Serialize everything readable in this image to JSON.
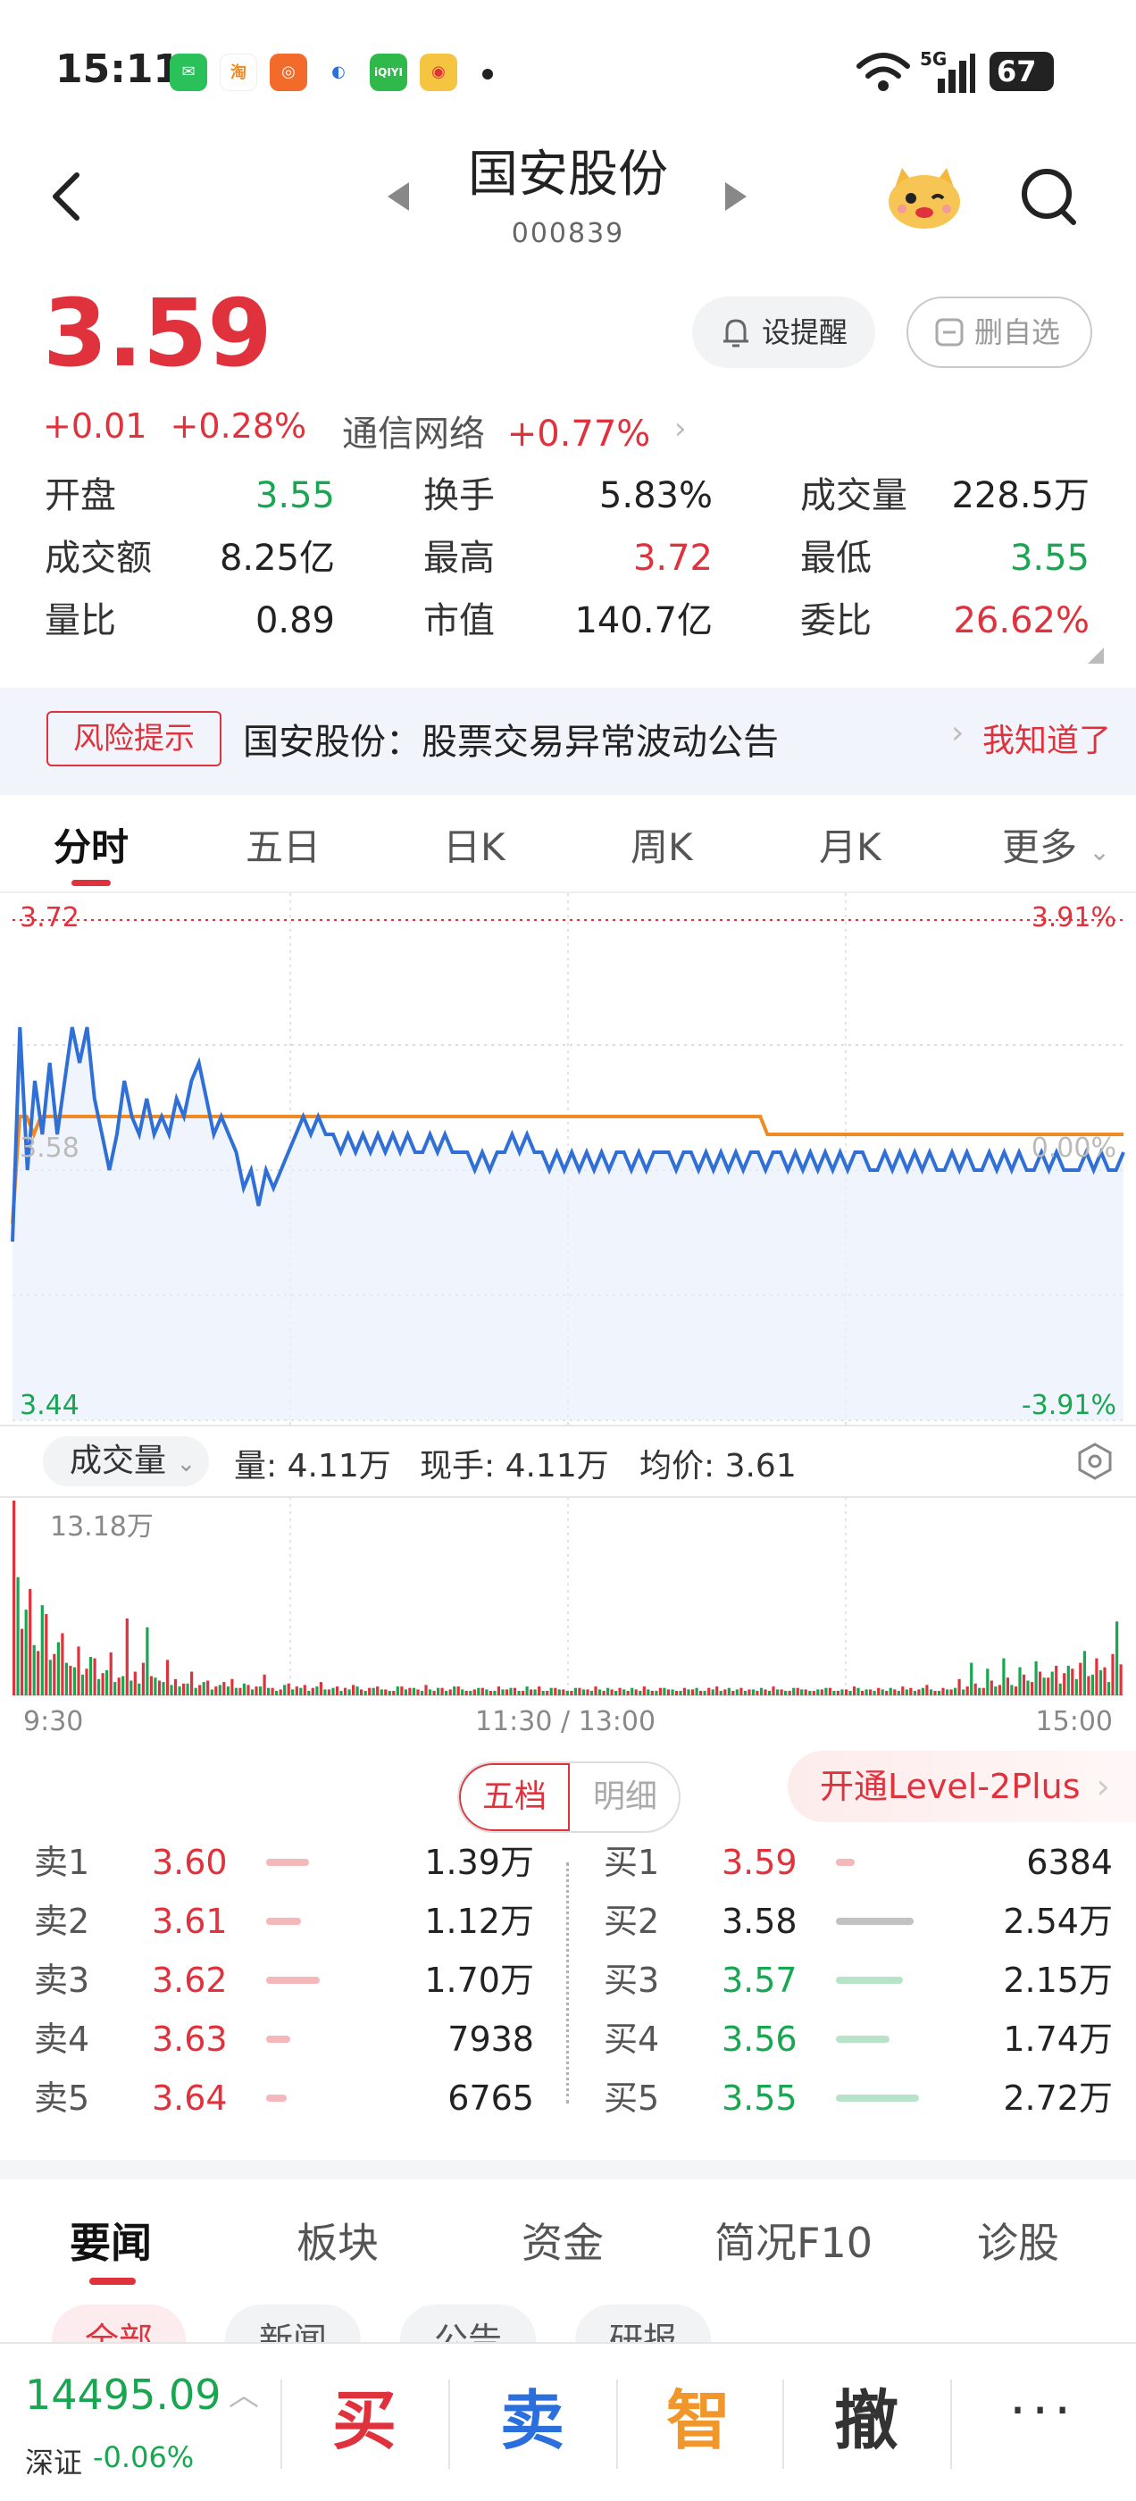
{
  "status_bar": {
    "time": "15:11",
    "network": "5G",
    "battery": "67"
  },
  "header": {
    "stock_name": "国安股份",
    "stock_code": "000839"
  },
  "quote": {
    "price": "3.59",
    "change": "+0.01",
    "change_pct": "+0.28%",
    "sector_name": "通信网络",
    "sector_pct": "+0.77%",
    "alert_label": "设提醒",
    "unfavorite_label": "删自选"
  },
  "stats": [
    {
      "label": "开盘",
      "value": "3.55",
      "color": "#18a651"
    },
    {
      "label": "换手",
      "value": "5.83%",
      "color": "#222222"
    },
    {
      "label": "成交量",
      "value": "228.5万",
      "color": "#222222"
    },
    {
      "label": "成交额",
      "value": "8.25亿",
      "color": "#222222"
    },
    {
      "label": "最高",
      "value": "3.72",
      "color": "#e0323c"
    },
    {
      "label": "最低",
      "value": "3.55",
      "color": "#18a651"
    },
    {
      "label": "量比",
      "value": "0.89",
      "color": "#222222"
    },
    {
      "label": "市值",
      "value": "140.7亿",
      "color": "#222222"
    },
    {
      "label": "委比",
      "value": "26.62%",
      "color": "#e0323c"
    }
  ],
  "risk_banner": {
    "tag": "风险提示",
    "message": "国安股份：股票交易异常波动公告",
    "action": "我知道了"
  },
  "chart_tabs": [
    "分时",
    "五日",
    "日K",
    "周K",
    "月K",
    "更多"
  ],
  "chart_data": [
    {
      "type": "line",
      "title": "分时",
      "y_labels": {
        "top": "3.72",
        "middle": "3.58",
        "bottom": "3.44"
      },
      "pct_labels": {
        "top": "3.91%",
        "middle": "0.00%",
        "bottom": "-3.91%"
      },
      "ylim": [
        3.44,
        3.72
      ],
      "prev_close": 3.58,
      "series": [
        {
          "color": "#2f6fd6",
          "values": [
            3.54,
            3.66,
            3.58,
            3.63,
            3.6,
            3.64,
            3.6,
            3.63,
            3.66,
            3.64,
            3.66,
            3.62,
            3.6,
            3.58,
            3.6,
            3.63,
            3.61,
            3.6,
            3.62,
            3.6,
            3.61,
            3.6,
            3.62,
            3.61,
            3.63,
            3.64,
            3.62,
            3.6,
            3.61,
            3.6,
            3.59,
            3.57,
            3.58,
            3.56,
            3.58,
            3.57,
            3.58,
            3.59,
            3.6,
            3.61,
            3.6,
            3.61,
            3.6,
            3.6,
            3.59,
            3.6,
            3.59,
            3.6,
            3.59,
            3.6,
            3.59,
            3.6,
            3.59,
            3.6,
            3.59,
            3.59,
            3.6,
            3.59,
            3.6,
            3.59,
            3.59,
            3.59,
            3.58,
            3.59,
            3.58,
            3.59,
            3.59,
            3.6,
            3.59,
            3.6,
            3.59,
            3.59,
            3.58,
            3.59,
            3.58,
            3.59,
            3.58,
            3.59,
            3.58,
            3.59,
            3.58,
            3.59,
            3.59,
            3.58,
            3.59,
            3.58,
            3.59,
            3.59,
            3.59,
            3.58,
            3.59,
            3.59,
            3.58,
            3.59,
            3.58,
            3.59,
            3.58,
            3.59,
            3.58,
            3.59,
            3.59,
            3.58,
            3.59,
            3.59,
            3.58,
            3.59,
            3.58,
            3.59,
            3.58,
            3.59,
            3.58,
            3.59,
            3.58,
            3.59,
            3.59,
            3.58,
            3.58,
            3.59,
            3.58,
            3.59,
            3.58,
            3.59,
            3.58,
            3.59,
            3.58,
            3.58,
            3.59,
            3.58,
            3.59,
            3.58,
            3.58,
            3.59,
            3.58,
            3.59,
            3.58,
            3.59,
            3.58,
            3.58,
            3.59,
            3.58,
            3.59,
            3.58,
            3.58,
            3.58,
            3.59,
            3.58,
            3.59,
            3.58,
            3.58,
            3.59
          ]
        },
        {
          "color": "#f08a24",
          "values": [
            3.55,
            3.61,
            3.61,
            3.6,
            3.61,
            3.61,
            3.61,
            3.61,
            3.61,
            3.61,
            3.61,
            3.61,
            3.61,
            3.61,
            3.61,
            3.61,
            3.61,
            3.61,
            3.61,
            3.61,
            3.61,
            3.61,
            3.61,
            3.61,
            3.61,
            3.61,
            3.61,
            3.61,
            3.61,
            3.61,
            3.61,
            3.61,
            3.61,
            3.61,
            3.61,
            3.61,
            3.61,
            3.61,
            3.61,
            3.61,
            3.61,
            3.61,
            3.61,
            3.61,
            3.61,
            3.61,
            3.61,
            3.61,
            3.61,
            3.61,
            3.61,
            3.61,
            3.61,
            3.61,
            3.61,
            3.61,
            3.61,
            3.61,
            3.61,
            3.61,
            3.61,
            3.61,
            3.61,
            3.61,
            3.61,
            3.61,
            3.61,
            3.61,
            3.61,
            3.61,
            3.61,
            3.61,
            3.61,
            3.61,
            3.61,
            3.61,
            3.61,
            3.61,
            3.61,
            3.61,
            3.61,
            3.61,
            3.61,
            3.61,
            3.61,
            3.61,
            3.61,
            3.61,
            3.61,
            3.61,
            3.61,
            3.61,
            3.61,
            3.61,
            3.61,
            3.61,
            3.61,
            3.61,
            3.61,
            3.61,
            3.61,
            3.61,
            3.61,
            3.61,
            3.61,
            3.61,
            3.6,
            3.6,
            3.6,
            3.6,
            3.6,
            3.6,
            3.6,
            3.6,
            3.6,
            3.6,
            3.6,
            3.6,
            3.6,
            3.6,
            3.6,
            3.6,
            3.6,
            3.6,
            3.6,
            3.6,
            3.6,
            3.6,
            3.6,
            3.6,
            3.6,
            3.6,
            3.6,
            3.6,
            3.6,
            3.6,
            3.6,
            3.6,
            3.6,
            3.6,
            3.6,
            3.6,
            3.6,
            3.6,
            3.6,
            3.6,
            3.6,
            3.6,
            3.6,
            3.6,
            3.6,
            3.6,
            3.6,
            3.6,
            3.6,
            3.6,
            3.6
          ]
        }
      ],
      "grid": true
    },
    {
      "type": "bar",
      "title": "成交量",
      "max_label": "13.18万",
      "x_labels": [
        "9:30",
        "11:30 / 13:00",
        "15:00"
      ],
      "ylim": [
        0,
        13.18
      ],
      "series": [
        {
          "name": "up",
          "color": "#e0323c",
          "values": [
            13.18,
            4.5,
            7.2,
            3.0,
            5.5,
            2.8,
            4.2,
            2.0,
            3.3,
            1.8,
            2.5,
            1.5,
            2.9,
            1.2,
            5.2,
            1.6,
            2.2,
            1.3,
            1.0,
            2.4,
            1.1,
            0.8,
            1.6,
            0.7,
            1.0,
            0.6,
            0.9,
            1.1,
            0.5,
            0.7,
            0.6,
            1.4,
            0.5,
            0.4,
            0.8,
            0.6,
            0.7,
            0.5,
            0.9,
            0.4,
            0.6,
            0.5,
            0.7,
            0.4,
            0.5,
            0.6,
            0.4,
            0.3,
            0.6,
            0.5,
            0.4,
            0.7,
            0.3,
            0.5,
            0.4,
            0.6,
            0.3,
            0.4,
            0.5,
            0.3,
            0.6,
            0.4,
            0.5,
            0.3,
            0.4,
            0.6,
            0.3,
            0.5,
            0.4,
            0.3,
            0.5,
            0.4,
            0.6,
            0.3,
            0.4,
            0.5,
            0.3,
            0.4,
            0.6,
            0.3,
            0.5,
            0.4,
            0.3,
            0.5,
            0.4,
            0.3,
            0.5,
            0.6,
            0.4,
            0.3,
            0.5,
            0.4,
            0.3,
            0.4,
            0.6,
            0.4,
            0.3,
            0.5,
            0.4,
            0.3,
            0.4,
            0.5,
            0.3,
            0.4,
            0.6,
            0.3,
            0.4,
            0.5,
            0.3,
            0.4,
            0.6,
            0.5,
            0.4,
            0.7,
            0.3,
            0.5,
            0.4,
            1.1,
            0.6,
            0.8,
            0.5,
            1.0,
            0.7,
            1.2,
            0.6,
            1.4,
            0.9,
            1.6,
            1.2,
            2.0,
            1.5,
            1.8,
            2.2,
            1.3,
            2.5,
            1.9,
            2.8,
            2.1
          ]
        },
        {
          "name": "down",
          "color": "#18a651",
          "values": [
            8.0,
            5.8,
            3.4,
            6.1,
            2.4,
            3.6,
            2.2,
            1.9,
            1.4,
            2.6,
            1.1,
            1.7,
            0.9,
            1.3,
            1.0,
            0.8,
            4.6,
            1.2,
            0.9,
            0.7,
            0.6,
            0.8,
            0.5,
            0.9,
            0.4,
            0.7,
            0.6,
            0.5,
            0.8,
            0.4,
            0.6,
            0.5,
            0.3,
            0.7,
            0.4,
            0.5,
            0.3,
            0.6,
            0.4,
            0.5,
            0.3,
            0.4,
            0.6,
            0.3,
            0.5,
            0.4,
            0.3,
            0.6,
            0.4,
            0.5,
            0.3,
            0.4,
            0.5,
            0.3,
            0.6,
            0.4,
            0.3,
            0.5,
            0.4,
            0.3,
            0.4,
            0.5,
            0.3,
            0.6,
            0.4,
            0.3,
            0.5,
            0.4,
            0.3,
            0.5,
            0.4,
            0.3,
            0.4,
            0.5,
            0.3,
            0.4,
            0.5,
            0.3,
            0.4,
            0.3,
            0.5,
            0.4,
            0.3,
            0.4,
            0.5,
            0.3,
            0.4,
            0.3,
            0.5,
            0.4,
            0.3,
            0.4,
            0.5,
            0.3,
            0.4,
            0.3,
            0.5,
            0.4,
            0.3,
            0.4,
            0.5,
            0.3,
            0.4,
            0.3,
            0.5,
            0.4,
            0.3,
            0.4,
            0.5,
            0.3,
            0.4,
            0.3,
            0.5,
            0.4,
            0.3,
            0.4,
            0.5,
            0.4,
            2.2,
            0.5,
            1.8,
            0.6,
            2.5,
            0.7,
            1.9,
            1.0,
            2.3,
            1.2,
            1.6,
            0.8,
            2.0,
            1.1,
            3.0,
            1.4,
            1.7,
            0.9,
            5.0
          ]
        }
      ]
    }
  ],
  "volume_bar": {
    "selector": "成交量",
    "vol_label": "量: 4.11万",
    "current_label": "现手: 4.11万",
    "avg_label": "均价: 3.61"
  },
  "order_book": {
    "seg_five": "五档",
    "seg_detail": "明细",
    "level2_label": "开通Level-2Plus",
    "sell": [
      {
        "level": "卖1",
        "price": "3.60",
        "volume": "1.39万",
        "color": "#e0323c",
        "bar_color": "#f4b7ba",
        "bar_fill": 0.32
      },
      {
        "level": "卖2",
        "price": "3.61",
        "volume": "1.12万",
        "color": "#e0323c",
        "bar_color": "#f4b7ba",
        "bar_fill": 0.26
      },
      {
        "level": "卖3",
        "price": "3.62",
        "volume": "1.70万",
        "color": "#e0323c",
        "bar_color": "#f4b7ba",
        "bar_fill": 0.4
      },
      {
        "level": "卖4",
        "price": "3.63",
        "volume": "7938",
        "color": "#e0323c",
        "bar_color": "#f4b7ba",
        "bar_fill": 0.18
      },
      {
        "level": "卖5",
        "price": "3.64",
        "volume": "6765",
        "color": "#e0323c",
        "bar_color": "#f4b7ba",
        "bar_fill": 0.15
      }
    ],
    "buy": [
      {
        "level": "买1",
        "price": "3.59",
        "volume": "6384",
        "color": "#e0323c",
        "bar_color": "#f4b7ba",
        "bar_fill": 0.14
      },
      {
        "level": "买2",
        "price": "3.58",
        "volume": "2.54万",
        "color": "#222222",
        "bar_color": "#c2c2c2",
        "bar_fill": 0.58
      },
      {
        "level": "买3",
        "price": "3.57",
        "volume": "2.15万",
        "color": "#18a651",
        "bar_color": "#b8e3c8",
        "bar_fill": 0.5
      },
      {
        "level": "买4",
        "price": "3.56",
        "volume": "1.74万",
        "color": "#18a651",
        "bar_color": "#b8e3c8",
        "bar_fill": 0.4
      },
      {
        "level": "买5",
        "price": "3.55",
        "volume": "2.72万",
        "color": "#18a651",
        "bar_color": "#b8e3c8",
        "bar_fill": 0.62
      }
    ]
  },
  "news_tabs": [
    "要闻",
    "板块",
    "资金",
    "简况F10",
    "诊股"
  ],
  "news_chips": [
    "全部",
    "新闻",
    "公告",
    "研报"
  ],
  "bottom_bar": {
    "index_value": "14495.09",
    "index_name": "深证",
    "index_change": "-0.06%",
    "buy": "买",
    "sell": "卖",
    "smart": "智",
    "cancel": "撤",
    "more": "···"
  },
  "colors": {
    "up": "#e0323c",
    "down": "#18a651",
    "avg_line": "#f08a24",
    "price_line": "#2f6fd6",
    "smart": "#f0962a",
    "sell_btn": "#2a6fdb",
    "cancel_btn": "#333333"
  }
}
